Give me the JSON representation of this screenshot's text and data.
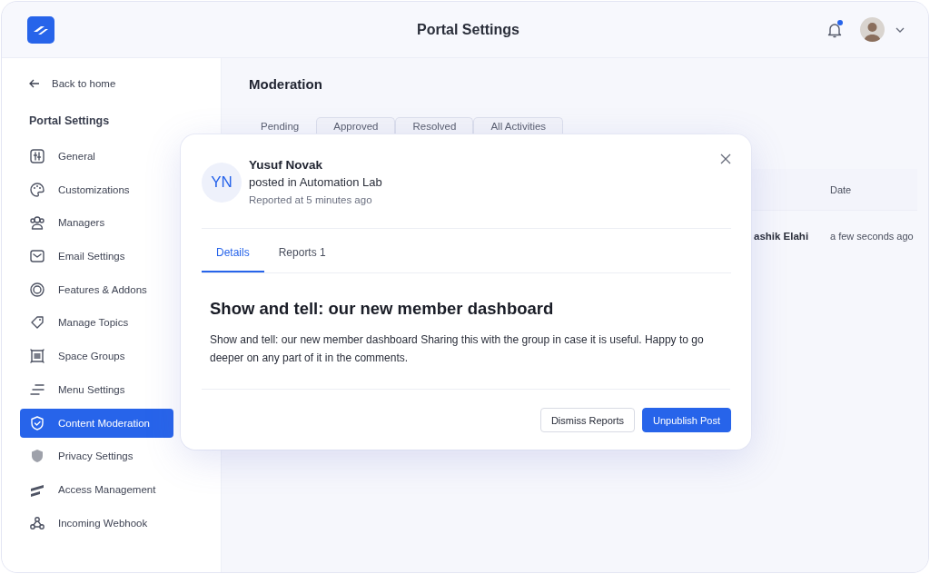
{
  "header": {
    "title": "Portal Settings",
    "notification_unread": true
  },
  "sidebar": {
    "back_link": "Back to home",
    "heading": "Portal Settings",
    "items": [
      {
        "label": "General",
        "selected": false
      },
      {
        "label": "Customizations",
        "selected": false
      },
      {
        "label": "Managers",
        "selected": false
      },
      {
        "label": "Email Settings",
        "selected": false
      },
      {
        "label": "Features & Addons",
        "selected": false
      },
      {
        "label": "Manage Topics",
        "selected": false
      },
      {
        "label": "Space Groups",
        "selected": false
      },
      {
        "label": "Menu Settings",
        "selected": false
      },
      {
        "label": "Content Moderation",
        "selected": true
      },
      {
        "label": "Privacy Settings",
        "selected": false
      },
      {
        "label": "Access Management",
        "selected": false
      },
      {
        "label": "Incoming Webhook",
        "selected": false
      }
    ]
  },
  "main": {
    "title": "Moderation",
    "tabs": [
      {
        "label": "Pending",
        "selected": true
      },
      {
        "label": "Approved",
        "selected": false
      },
      {
        "label": "Resolved",
        "selected": false
      },
      {
        "label": "All Activities",
        "selected": false
      }
    ],
    "table": {
      "columns": [
        "",
        "Date"
      ],
      "rows": [
        {
          "cells": [
            "ashik Elahi",
            "a few seconds ago"
          ]
        }
      ]
    }
  },
  "dialog": {
    "avatar_initials": "YN",
    "author": "Yusuf Novak",
    "context": "posted in Automation Lab",
    "reported": "Reported at 5 minutes ago",
    "tabs": [
      {
        "label": "Details",
        "selected": true
      },
      {
        "label": "Reports 1",
        "selected": false
      }
    ],
    "post_title": "Show and tell: our new member dashboard",
    "post_body": "Show and tell: our new member dashboard Sharing this with the group in case it is useful. Happy to go deeper on any part of it in the comments.",
    "buttons": [
      {
        "label": "Dismiss Reports",
        "kind": "secondary"
      },
      {
        "label": "Unpublish Post",
        "kind": "primary"
      }
    ]
  }
}
